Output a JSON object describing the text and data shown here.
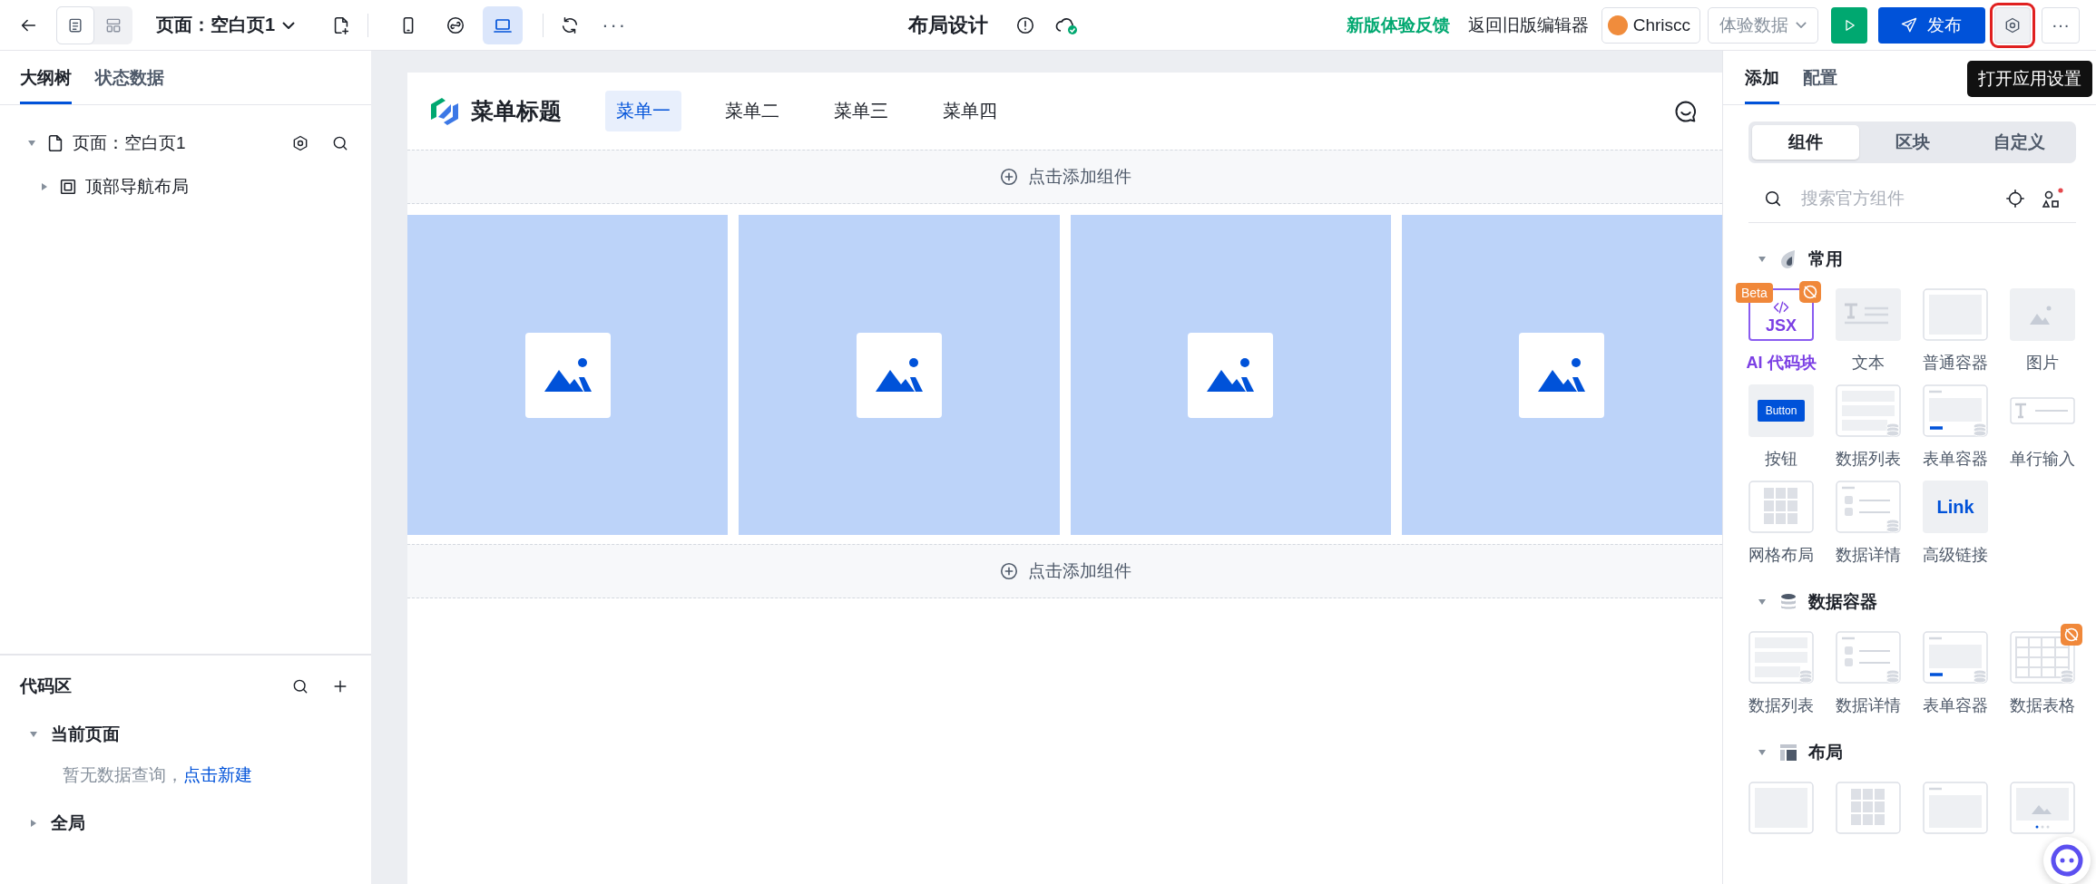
{
  "toolbar": {
    "view_modes": [
      {
        "kind": "outline",
        "selected": true
      },
      {
        "kind": "layout",
        "selected": false
      }
    ],
    "page_selector": "页面：空白页1",
    "devices": [
      {
        "kind": "phone",
        "selected": false
      },
      {
        "kind": "mini",
        "selected": false
      },
      {
        "kind": "desktop",
        "selected": true
      }
    ],
    "more": "···",
    "title": "布局设计",
    "feedback_link": "新版体验反馈",
    "legacy_link": "返回旧版编辑器",
    "user": "Chriscc",
    "data_select": "体验数据",
    "publish": "发布",
    "settings_highlighted": true,
    "settings_tooltip": "打开应用设置",
    "more_menu": "···"
  },
  "outline_panel": {
    "tabs": [
      {
        "label": "大纲树",
        "selected": true
      },
      {
        "label": "状态数据",
        "selected": false
      }
    ],
    "tree": [
      {
        "label": "页面：空白页1",
        "kind": "page",
        "expanded": true,
        "children": [
          {
            "label": "顶部导航布局",
            "kind": "layout",
            "expanded": false
          }
        ]
      }
    ],
    "code_area": {
      "title": "代码区",
      "groups": [
        {
          "label": "当前页面",
          "expanded": true,
          "empty_text": "暂无数据查询，",
          "create_link": "点击新建"
        },
        {
          "label": "全局",
          "expanded": false
        }
      ]
    }
  },
  "canvas": {
    "brand": "菜单标题",
    "menu": [
      {
        "label": "菜单一",
        "selected": true
      },
      {
        "label": "菜单二",
        "selected": false
      },
      {
        "label": "菜单三",
        "selected": false
      },
      {
        "label": "菜单四",
        "selected": false
      }
    ],
    "blocks": [
      {
        "kind": "add",
        "label": "点击添加组件"
      },
      {
        "kind": "images",
        "items": [
          {
            "kind": "image_placeholder"
          },
          {
            "kind": "image_placeholder"
          },
          {
            "kind": "image_placeholder"
          },
          {
            "kind": "image_placeholder"
          }
        ]
      },
      {
        "kind": "add",
        "label": "点击添加组件"
      }
    ]
  },
  "component_panel": {
    "tabs": [
      {
        "label": "添加",
        "selected": true
      },
      {
        "label": "配置",
        "selected": false
      }
    ],
    "segments": [
      {
        "label": "组件",
        "selected": true
      },
      {
        "label": "区块",
        "selected": false
      },
      {
        "label": "自定义",
        "selected": false
      }
    ],
    "search": {
      "placeholder": "搜索官方组件"
    },
    "sections": [
      {
        "title": "常用",
        "kind": "common",
        "expanded": true,
        "items": [
          {
            "kind": "jsx",
            "label": "AI 代码块",
            "tile_text": "JSX",
            "badge": "Beta",
            "restricted": true
          },
          {
            "kind": "text",
            "label": "文本",
            "restricted": false
          },
          {
            "kind": "container",
            "label": "普通容器",
            "restricted": false
          },
          {
            "kind": "image",
            "label": "图片",
            "restricted": false
          },
          {
            "kind": "button",
            "label": "按钮",
            "tile_text": "Button",
            "restricted": false
          },
          {
            "kind": "list",
            "label": "数据列表",
            "restricted": false
          },
          {
            "kind": "form",
            "label": "表单容器",
            "restricted": false
          },
          {
            "kind": "input",
            "label": "单行输入",
            "restricted": false
          },
          {
            "kind": "grid",
            "label": "网格布局",
            "restricted": false
          },
          {
            "kind": "detail",
            "label": "数据详情",
            "restricted": false
          },
          {
            "kind": "link",
            "label": "高级链接",
            "tile_text": "Link",
            "restricted": false
          }
        ]
      },
      {
        "title": "数据容器",
        "kind": "data",
        "expanded": true,
        "items": [
          {
            "kind": "list",
            "label": "数据列表",
            "restricted": false
          },
          {
            "kind": "detail",
            "label": "数据详情",
            "restricted": false
          },
          {
            "kind": "form",
            "label": "表单容器",
            "restricted": false
          },
          {
            "kind": "table",
            "label": "数据表格",
            "restricted": true
          }
        ]
      },
      {
        "title": "布局",
        "kind": "layout",
        "expanded": true,
        "items": [
          {
            "kind": "container",
            "restricted": false
          },
          {
            "kind": "grid",
            "restricted": false
          },
          {
            "kind": "card",
            "restricted": false
          },
          {
            "kind": "carousel",
            "restricted": false
          }
        ]
      }
    ]
  }
}
